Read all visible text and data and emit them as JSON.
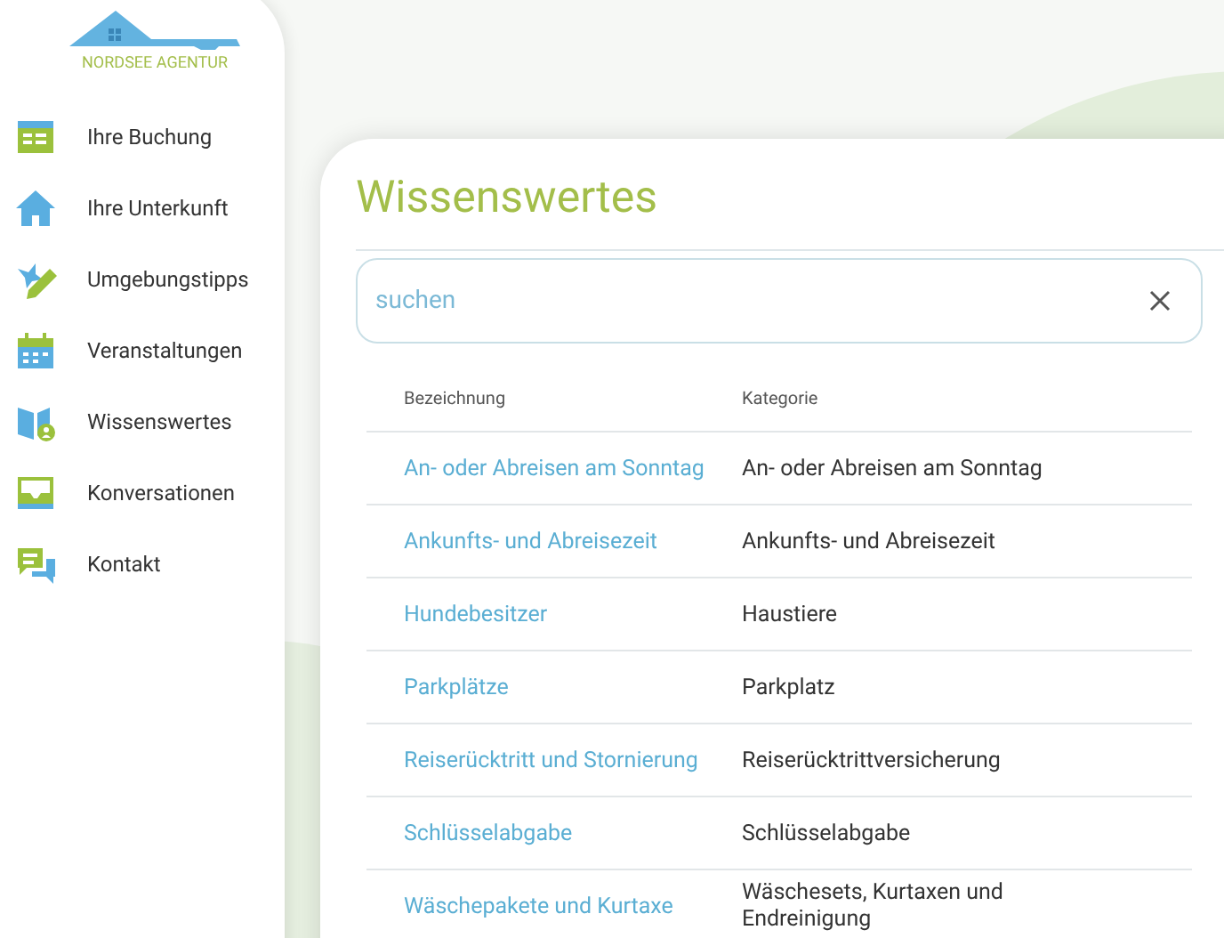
{
  "logo": {
    "text": "NORDSEE AGENTUR"
  },
  "nav": [
    {
      "label": "Ihre Buchung",
      "kind": "booking"
    },
    {
      "label": "Ihre Unterkunft",
      "kind": "house"
    },
    {
      "label": "Umgebungstipps",
      "kind": "tips"
    },
    {
      "label": "Veranstaltungen",
      "kind": "calendar"
    },
    {
      "label": "Wissenswertes",
      "kind": "book"
    },
    {
      "label": "Konversationen",
      "kind": "inbox"
    },
    {
      "label": "Kontakt",
      "kind": "chat"
    }
  ],
  "page": {
    "title": "Wissenswertes"
  },
  "search": {
    "placeholder": "suchen"
  },
  "table": {
    "columns": [
      "Bezeichnung",
      "Kategorie"
    ],
    "rows": [
      [
        "An- oder Abreisen am Sonntag",
        "An- oder Abreisen am Sonntag"
      ],
      [
        "Ankunfts- und Abreisezeit",
        "Ankunfts- und Abreisezeit"
      ],
      [
        "Hundebesitzer",
        "Haustiere"
      ],
      [
        "Parkplätze",
        "Parkplatz"
      ],
      [
        "Reiserücktritt und Stornierung",
        "Reiserücktrittversicherung"
      ],
      [
        "Schlüsselabgabe",
        "Schlüsselabgabe"
      ],
      [
        "Wäschepakete und Kurtaxe",
        "Wäschesets, Kurtaxen und Endreinigung"
      ]
    ]
  }
}
